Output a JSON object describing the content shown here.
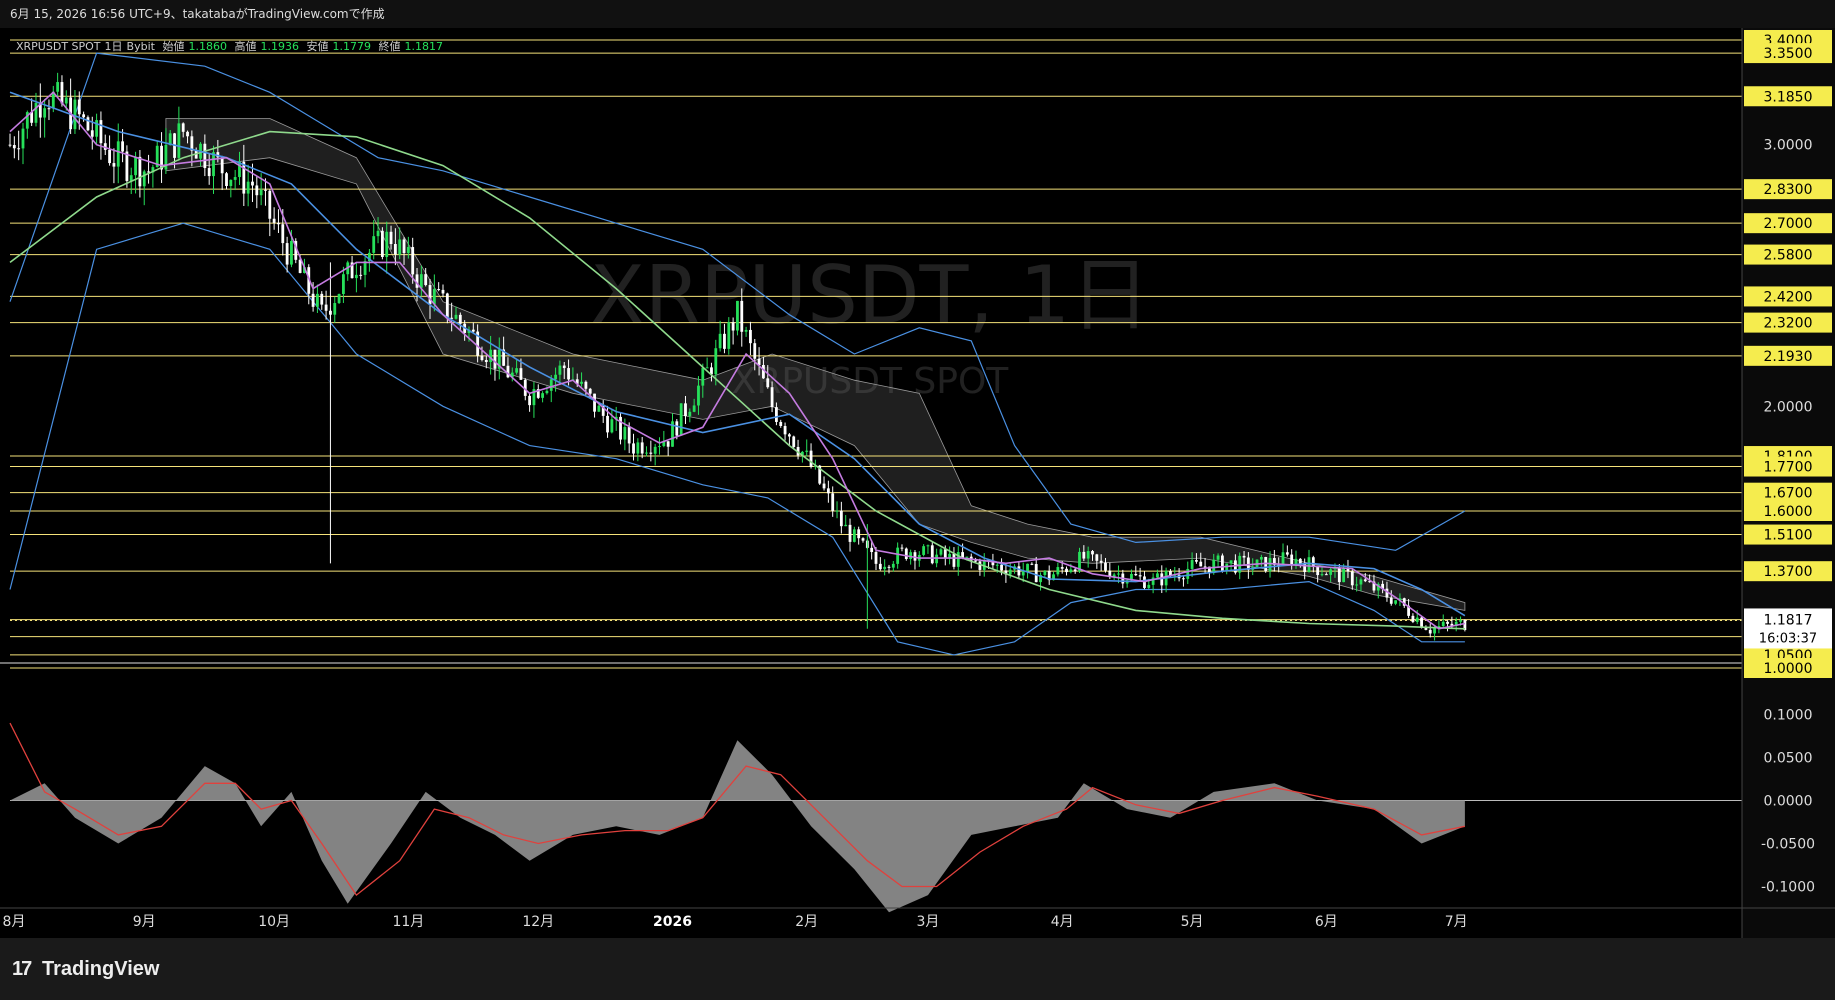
{
  "header": {
    "caption": "6月 15, 2026 16:56 UTC+9、takatabaがTradingView.comで作成"
  },
  "legend": {
    "symbol": "XRPUSDT SPOT",
    "interval": "1日",
    "exchange": "Bybit",
    "open_label": "始値",
    "open": "1.1860",
    "high_label": "高値",
    "high": "1.1936",
    "low_label": "安値",
    "low": "1.1779",
    "close_label": "終値",
    "close": "1.1817"
  },
  "watermark": {
    "title": "XRPUSDT, 1日",
    "subtitle": "XRPUSDT SPOT"
  },
  "footer": {
    "brand": "TradingView"
  },
  "colors": {
    "up": "#26e05a",
    "down": "#ffffff",
    "hline": "#f5e27a",
    "price_label_bg": "#f5ec4e",
    "bb": "#4a90e2",
    "sma_short": "#c47be0",
    "sma_mid": "#4a90e2",
    "sma_long": "#8fd98c",
    "macd_hist": "#8a8a8a",
    "macd_signal": "#e0413d",
    "cloud": "#6e6e6e"
  },
  "chart_data": {
    "type": "candlestick",
    "price_axis": {
      "ylim": [
        1.0,
        3.4
      ],
      "tick_labels": [
        "3.0000",
        "2.0000"
      ],
      "level_labels": [
        "3.4000",
        "3.3500",
        "3.1850",
        "2.8300",
        "2.7000",
        "2.5800",
        "2.4200",
        "2.3200",
        "2.1930",
        "1.8100",
        "1.7700",
        "1.6700",
        "1.6000",
        "1.5100",
        "1.3700",
        "1.1850",
        "1.1200",
        "1.0500",
        "1.0000"
      ],
      "levels": [
        3.4,
        3.35,
        3.185,
        2.83,
        2.7,
        2.58,
        2.42,
        2.32,
        2.193,
        1.81,
        1.77,
        1.67,
        1.6,
        1.51,
        1.37,
        1.185,
        1.12,
        1.05,
        1.0
      ],
      "last_price": "1.1817",
      "countdown": "16:03:37"
    },
    "time_axis": {
      "labels": [
        "8月",
        "9月",
        "10月",
        "11月",
        "12月",
        "2026",
        "2月",
        "3月",
        "4月",
        "5月",
        "6月",
        "7月"
      ]
    },
    "price_path": [
      [
        0,
        3.0
      ],
      [
        8,
        3.2
      ],
      [
        16,
        3.1
      ],
      [
        24,
        2.95
      ],
      [
        32,
        2.9
      ],
      [
        40,
        3.05
      ],
      [
        48,
        2.92
      ],
      [
        56,
        2.85
      ],
      [
        64,
        2.6
      ],
      [
        72,
        2.35
      ],
      [
        80,
        2.55
      ],
      [
        88,
        2.65
      ],
      [
        96,
        2.45
      ],
      [
        104,
        2.32
      ],
      [
        112,
        2.18
      ],
      [
        120,
        2.05
      ],
      [
        128,
        2.15
      ],
      [
        136,
        1.98
      ],
      [
        144,
        1.85
      ],
      [
        152,
        1.88
      ],
      [
        160,
        2.1
      ],
      [
        168,
        2.35
      ],
      [
        176,
        2.0
      ],
      [
        184,
        1.8
      ],
      [
        192,
        1.55
      ],
      [
        200,
        1.4
      ],
      [
        208,
        1.45
      ],
      [
        216,
        1.42
      ],
      [
        224,
        1.4
      ],
      [
        232,
        1.38
      ],
      [
        240,
        1.35
      ],
      [
        248,
        1.42
      ],
      [
        256,
        1.36
      ],
      [
        264,
        1.33
      ],
      [
        272,
        1.38
      ],
      [
        280,
        1.4
      ],
      [
        288,
        1.39
      ],
      [
        296,
        1.42
      ],
      [
        304,
        1.37
      ],
      [
        312,
        1.33
      ],
      [
        320,
        1.26
      ],
      [
        328,
        1.15
      ],
      [
        336,
        1.17
      ]
    ],
    "bands": {
      "upper": [
        [
          0,
          2.4
        ],
        [
          20,
          3.35
        ],
        [
          45,
          3.3
        ],
        [
          60,
          3.2
        ],
        [
          70,
          3.1
        ],
        [
          85,
          2.95
        ],
        [
          100,
          2.9
        ],
        [
          120,
          2.8
        ],
        [
          140,
          2.7
        ],
        [
          160,
          2.6
        ],
        [
          180,
          2.35
        ],
        [
          195,
          2.2
        ],
        [
          210,
          2.3
        ],
        [
          222,
          2.25
        ],
        [
          232,
          1.85
        ],
        [
          245,
          1.55
        ],
        [
          260,
          1.48
        ],
        [
          280,
          1.5
        ],
        [
          300,
          1.5
        ],
        [
          320,
          1.45
        ],
        [
          336,
          1.6
        ]
      ],
      "lower": [
        [
          0,
          1.3
        ],
        [
          20,
          2.6
        ],
        [
          40,
          2.7
        ],
        [
          60,
          2.6
        ],
        [
          80,
          2.2
        ],
        [
          100,
          2.0
        ],
        [
          120,
          1.85
        ],
        [
          140,
          1.8
        ],
        [
          160,
          1.7
        ],
        [
          175,
          1.65
        ],
        [
          190,
          1.5
        ],
        [
          205,
          1.1
        ],
        [
          218,
          1.05
        ],
        [
          232,
          1.1
        ],
        [
          245,
          1.25
        ],
        [
          260,
          1.3
        ],
        [
          280,
          1.3
        ],
        [
          300,
          1.33
        ],
        [
          315,
          1.22
        ],
        [
          326,
          1.1
        ],
        [
          336,
          1.1
        ]
      ]
    },
    "ma_short": [
      [
        0,
        3.05
      ],
      [
        10,
        3.2
      ],
      [
        20,
        3.0
      ],
      [
        35,
        2.92
      ],
      [
        50,
        2.95
      ],
      [
        60,
        2.85
      ],
      [
        70,
        2.45
      ],
      [
        80,
        2.55
      ],
      [
        90,
        2.55
      ],
      [
        100,
        2.35
      ],
      [
        110,
        2.2
      ],
      [
        120,
        2.05
      ],
      [
        130,
        2.1
      ],
      [
        140,
        1.95
      ],
      [
        150,
        1.86
      ],
      [
        160,
        1.92
      ],
      [
        170,
        2.2
      ],
      [
        180,
        2.05
      ],
      [
        190,
        1.8
      ],
      [
        200,
        1.45
      ],
      [
        210,
        1.42
      ],
      [
        220,
        1.42
      ],
      [
        230,
        1.4
      ],
      [
        240,
        1.42
      ],
      [
        250,
        1.36
      ],
      [
        262,
        1.33
      ],
      [
        275,
        1.38
      ],
      [
        290,
        1.4
      ],
      [
        300,
        1.39
      ],
      [
        310,
        1.38
      ],
      [
        320,
        1.27
      ],
      [
        330,
        1.15
      ],
      [
        336,
        1.17
      ]
    ],
    "ma_mid": [
      [
        0,
        3.2
      ],
      [
        25,
        3.05
      ],
      [
        50,
        2.95
      ],
      [
        65,
        2.85
      ],
      [
        80,
        2.6
      ],
      [
        100,
        2.35
      ],
      [
        120,
        2.15
      ],
      [
        140,
        1.98
      ],
      [
        160,
        1.9
      ],
      [
        180,
        1.97
      ],
      [
        195,
        1.8
      ],
      [
        210,
        1.55
      ],
      [
        225,
        1.42
      ],
      [
        240,
        1.34
      ],
      [
        260,
        1.33
      ],
      [
        280,
        1.37
      ],
      [
        300,
        1.4
      ],
      [
        315,
        1.38
      ],
      [
        326,
        1.3
      ],
      [
        336,
        1.2
      ]
    ],
    "ma_long": [
      [
        0,
        2.55
      ],
      [
        20,
        2.8
      ],
      [
        40,
        2.95
      ],
      [
        60,
        3.05
      ],
      [
        80,
        3.03
      ],
      [
        100,
        2.92
      ],
      [
        120,
        2.72
      ],
      [
        140,
        2.45
      ],
      [
        160,
        2.15
      ],
      [
        180,
        1.85
      ],
      [
        200,
        1.6
      ],
      [
        220,
        1.42
      ],
      [
        240,
        1.3
      ],
      [
        260,
        1.22
      ],
      [
        280,
        1.19
      ],
      [
        300,
        1.17
      ],
      [
        320,
        1.16
      ],
      [
        336,
        1.15
      ]
    ],
    "cloud_top": [
      [
        36,
        3.1
      ],
      [
        60,
        3.1
      ],
      [
        80,
        2.95
      ],
      [
        100,
        2.4
      ],
      [
        130,
        2.2
      ],
      [
        160,
        2.1
      ],
      [
        176,
        2.2
      ],
      [
        195,
        2.1
      ],
      [
        210,
        2.05
      ],
      [
        222,
        1.62
      ],
      [
        235,
        1.55
      ],
      [
        250,
        1.5
      ],
      [
        275,
        1.5
      ],
      [
        300,
        1.4
      ],
      [
        315,
        1.35
      ],
      [
        336,
        1.25
      ]
    ],
    "cloud_bottom": [
      [
        36,
        2.9
      ],
      [
        60,
        2.95
      ],
      [
        80,
        2.85
      ],
      [
        100,
        2.2
      ],
      [
        130,
        2.05
      ],
      [
        160,
        1.95
      ],
      [
        176,
        2.0
      ],
      [
        195,
        1.85
      ],
      [
        210,
        1.55
      ],
      [
        222,
        1.48
      ],
      [
        235,
        1.42
      ],
      [
        250,
        1.4
      ],
      [
        275,
        1.42
      ],
      [
        300,
        1.35
      ],
      [
        315,
        1.28
      ],
      [
        336,
        1.22
      ]
    ],
    "macd_axis": {
      "ylim": [
        -0.125,
        0.125
      ],
      "tick_labels": [
        "0.1000",
        "0.0500",
        "0.0000",
        "-0.0500",
        "-0.1000"
      ],
      "ticks": [
        0.1,
        0.05,
        0.0,
        -0.05,
        -0.1
      ]
    },
    "macd_hist": [
      [
        0,
        0.0
      ],
      [
        8,
        0.02
      ],
      [
        15,
        -0.02
      ],
      [
        25,
        -0.05
      ],
      [
        35,
        -0.02
      ],
      [
        45,
        0.04
      ],
      [
        52,
        0.02
      ],
      [
        58,
        -0.03
      ],
      [
        65,
        0.01
      ],
      [
        72,
        -0.07
      ],
      [
        78,
        -0.12
      ],
      [
        88,
        -0.05
      ],
      [
        96,
        0.01
      ],
      [
        104,
        -0.02
      ],
      [
        112,
        -0.04
      ],
      [
        120,
        -0.07
      ],
      [
        130,
        -0.04
      ],
      [
        140,
        -0.03
      ],
      [
        150,
        -0.04
      ],
      [
        160,
        -0.02
      ],
      [
        168,
        0.07
      ],
      [
        176,
        0.03
      ],
      [
        185,
        -0.03
      ],
      [
        195,
        -0.08
      ],
      [
        203,
        -0.13
      ],
      [
        212,
        -0.11
      ],
      [
        222,
        -0.04
      ],
      [
        232,
        -0.03
      ],
      [
        242,
        -0.02
      ],
      [
        248,
        0.02
      ],
      [
        258,
        -0.01
      ],
      [
        268,
        -0.02
      ],
      [
        278,
        0.01
      ],
      [
        292,
        0.02
      ],
      [
        302,
        0.0
      ],
      [
        315,
        -0.01
      ],
      [
        326,
        -0.05
      ],
      [
        336,
        -0.03
      ]
    ],
    "macd_signal": [
      [
        0,
        0.09
      ],
      [
        8,
        0.01
      ],
      [
        15,
        -0.01
      ],
      [
        25,
        -0.04
      ],
      [
        35,
        -0.03
      ],
      [
        45,
        0.02
      ],
      [
        52,
        0.02
      ],
      [
        58,
        -0.01
      ],
      [
        65,
        0.0
      ],
      [
        72,
        -0.05
      ],
      [
        80,
        -0.11
      ],
      [
        90,
        -0.07
      ],
      [
        98,
        -0.01
      ],
      [
        106,
        -0.02
      ],
      [
        114,
        -0.04
      ],
      [
        122,
        -0.05
      ],
      [
        132,
        -0.04
      ],
      [
        142,
        -0.035
      ],
      [
        152,
        -0.035
      ],
      [
        160,
        -0.02
      ],
      [
        170,
        0.04
      ],
      [
        178,
        0.03
      ],
      [
        188,
        -0.02
      ],
      [
        198,
        -0.07
      ],
      [
        206,
        -0.1
      ],
      [
        214,
        -0.1
      ],
      [
        224,
        -0.06
      ],
      [
        234,
        -0.03
      ],
      [
        244,
        -0.01
      ],
      [
        250,
        0.015
      ],
      [
        260,
        -0.005
      ],
      [
        270,
        -0.015
      ],
      [
        280,
        0.0
      ],
      [
        292,
        0.015
      ],
      [
        302,
        0.005
      ],
      [
        315,
        -0.01
      ],
      [
        326,
        -0.04
      ],
      [
        336,
        -0.03
      ]
    ]
  }
}
